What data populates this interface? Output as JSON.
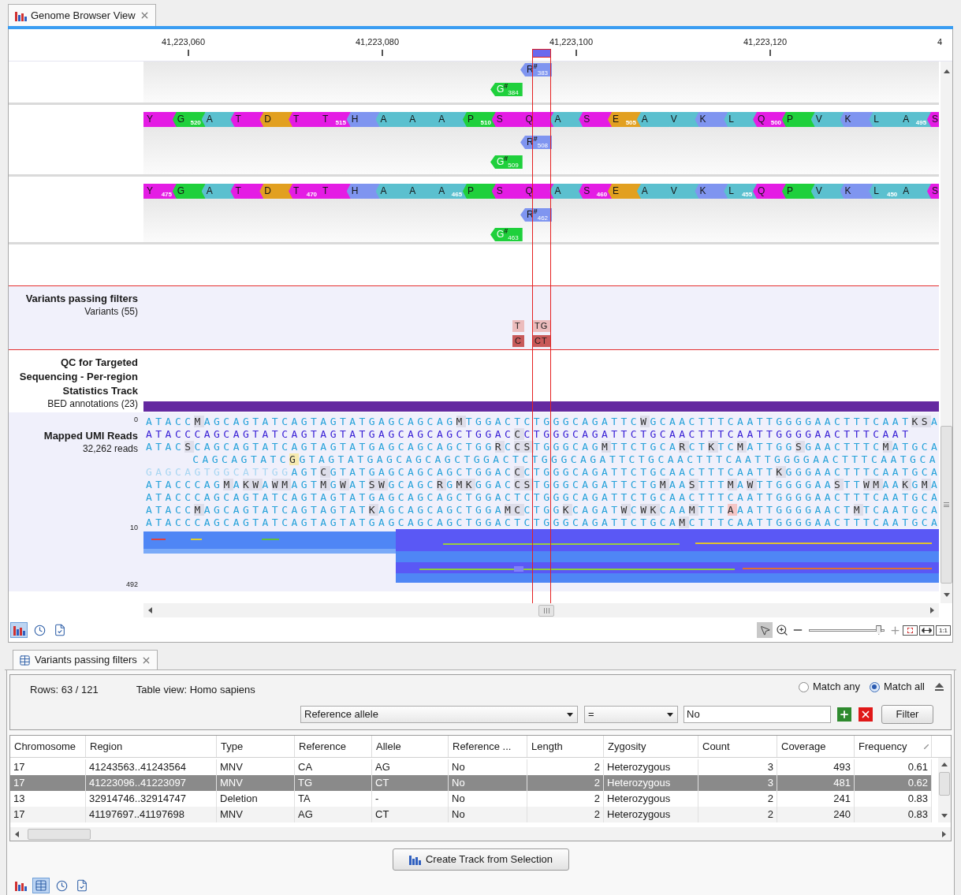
{
  "browser_tab": {
    "title": "Genome Browser View"
  },
  "ruler": {
    "ticks": [
      "41,223,060",
      "41,223,080",
      "41,223,100",
      "41,223,120",
      "4"
    ]
  },
  "translation_tracks": [
    {
      "features": [
        {
          "letter": "R",
          "mark": "#",
          "number": "383",
          "color": "#7f95f0"
        },
        {
          "letter": "G",
          "mark": "#",
          "number": "384",
          "color": "#1fd03c"
        }
      ]
    },
    {
      "amino_acids": [
        {
          "letter": "Y",
          "color": "#e41ce4"
        },
        {
          "letter": "G",
          "number": "520",
          "color": "#1fd03c"
        },
        {
          "letter": "A",
          "color": "#5bc0cf"
        },
        {
          "letter": "T",
          "color": "#e41ce4"
        },
        {
          "letter": "D",
          "color": "#e2a020"
        },
        {
          "letter": "T",
          "color": "#e41ce4"
        },
        {
          "letter": "T",
          "number": "515",
          "color": "#e41ce4"
        },
        {
          "letter": "H",
          "color": "#7f95f0"
        },
        {
          "letter": "A",
          "color": "#5bc0cf"
        },
        {
          "letter": "A",
          "color": "#5bc0cf"
        },
        {
          "letter": "A",
          "color": "#5bc0cf"
        },
        {
          "letter": "P",
          "number": "510",
          "color": "#1fd03c"
        },
        {
          "letter": "S",
          "color": "#e41ce4"
        },
        {
          "letter": "Q",
          "color": "#e41ce4"
        },
        {
          "letter": "A",
          "color": "#5bc0cf"
        },
        {
          "letter": "S",
          "color": "#e41ce4"
        },
        {
          "letter": "E",
          "number": "505",
          "color": "#e2a020"
        },
        {
          "letter": "A",
          "color": "#5bc0cf"
        },
        {
          "letter": "V",
          "color": "#5bc0cf"
        },
        {
          "letter": "K",
          "color": "#7f95f0"
        },
        {
          "letter": "L",
          "color": "#5bc0cf"
        },
        {
          "letter": "Q",
          "number": "500",
          "color": "#e41ce4"
        },
        {
          "letter": "P",
          "color": "#1fd03c"
        },
        {
          "letter": "V",
          "color": "#5bc0cf"
        },
        {
          "letter": "K",
          "color": "#7f95f0"
        },
        {
          "letter": "L",
          "color": "#5bc0cf"
        },
        {
          "letter": "A",
          "number": "495",
          "color": "#5bc0cf"
        },
        {
          "letter": "S",
          "color": "#e41ce4"
        }
      ],
      "features": [
        {
          "letter": "R",
          "mark": "#",
          "number": "508",
          "color": "#7f95f0"
        },
        {
          "letter": "G",
          "mark": "#",
          "number": "509",
          "color": "#1fd03c"
        }
      ]
    },
    {
      "amino_acids": [
        {
          "letter": "Y",
          "number": "475",
          "color": "#e41ce4"
        },
        {
          "letter": "G",
          "color": "#1fd03c"
        },
        {
          "letter": "A",
          "color": "#5bc0cf"
        },
        {
          "letter": "T",
          "color": "#e41ce4"
        },
        {
          "letter": "D",
          "color": "#e2a020"
        },
        {
          "letter": "T",
          "number": "470",
          "color": "#e41ce4"
        },
        {
          "letter": "T",
          "color": "#e41ce4"
        },
        {
          "letter": "H",
          "color": "#7f95f0"
        },
        {
          "letter": "A",
          "color": "#5bc0cf"
        },
        {
          "letter": "A",
          "color": "#5bc0cf"
        },
        {
          "letter": "A",
          "number": "465",
          "color": "#5bc0cf"
        },
        {
          "letter": "P",
          "color": "#1fd03c"
        },
        {
          "letter": "S",
          "color": "#e41ce4"
        },
        {
          "letter": "Q",
          "color": "#e41ce4"
        },
        {
          "letter": "A",
          "color": "#5bc0cf"
        },
        {
          "letter": "S",
          "number": "460",
          "color": "#e41ce4"
        },
        {
          "letter": "E",
          "color": "#e2a020"
        },
        {
          "letter": "A",
          "color": "#5bc0cf"
        },
        {
          "letter": "V",
          "color": "#5bc0cf"
        },
        {
          "letter": "K",
          "color": "#7f95f0"
        },
        {
          "letter": "L",
          "number": "455",
          "color": "#5bc0cf"
        },
        {
          "letter": "Q",
          "color": "#e41ce4"
        },
        {
          "letter": "P",
          "color": "#1fd03c"
        },
        {
          "letter": "V",
          "color": "#5bc0cf"
        },
        {
          "letter": "K",
          "color": "#7f95f0"
        },
        {
          "letter": "L",
          "number": "450",
          "color": "#5bc0cf"
        },
        {
          "letter": "A",
          "color": "#5bc0cf"
        },
        {
          "letter": "S",
          "color": "#e41ce4"
        }
      ],
      "features": [
        {
          "letter": "R",
          "mark": "#",
          "number": "462",
          "color": "#7f95f0"
        },
        {
          "letter": "G",
          "mark": "#",
          "number": "463",
          "color": "#1fd03c"
        }
      ]
    }
  ],
  "variant_track": {
    "title": "Variants passing filters",
    "subtitle": "Variants (55)",
    "variants": [
      {
        "reference": "T",
        "allele": "C"
      },
      {
        "reference": "TG",
        "allele": "CT"
      }
    ]
  },
  "qc_track": {
    "title": "QC for Targeted Sequencing - Per-region Statistics Track",
    "subtitle": "BED annotations (23)"
  },
  "reads_track": {
    "title": "Mapped UMI Reads",
    "subtitle": "32,262 reads",
    "axis": [
      "0",
      "10",
      "492"
    ],
    "reads": [
      {
        "kind": "read",
        "segments": [
          {
            "text": "ATACC",
            "kind": "match"
          },
          {
            "text": "M",
            "kind": "variant"
          },
          {
            "text": "AGCAGTATCAGTAGTATGAGCAGCAG",
            "kind": "match"
          },
          {
            "text": "M",
            "kind": "variant"
          },
          {
            "text": "TGGACTCTGGGCAGATTC",
            "kind": "match"
          },
          {
            "text": "W",
            "kind": "variant"
          },
          {
            "text": "GCAACTTTCAATTGGGGAACTTTCAAT",
            "kind": "match"
          },
          {
            "text": "KS",
            "kind": "variant"
          },
          {
            "text": "A",
            "kind": "match"
          }
        ]
      },
      {
        "kind": "consensus",
        "segments": [
          {
            "text": "ATACCCAGCAGTATCAGTAGTATGAGCAGCAGCTGGAC",
            "kind": "match"
          },
          {
            "text": "C",
            "kind": "variant"
          },
          {
            "text": "CTGGGCAGATTCTGCAACTTTCAATTGGGGAACTTTCAAT",
            "kind": "match"
          }
        ]
      },
      {
        "kind": "read",
        "segments": [
          {
            "text": "ATAC",
            "kind": "match"
          },
          {
            "text": "S",
            "kind": "variant"
          },
          {
            "text": "CAGCAGTATCAGTAGTATGAGCAGCAGCTGG",
            "kind": "match"
          },
          {
            "text": "R",
            "kind": "variant"
          },
          {
            "text": "C",
            "kind": "match"
          },
          {
            "text": "CS",
            "kind": "variant"
          },
          {
            "text": "TGGGCAG",
            "kind": "match"
          },
          {
            "text": "M",
            "kind": "variant"
          },
          {
            "text": "TTCTGCA",
            "kind": "match"
          },
          {
            "text": "R",
            "kind": "variant"
          },
          {
            "text": "CT",
            "kind": "match"
          },
          {
            "text": "K",
            "kind": "variant"
          },
          {
            "text": "TC",
            "kind": "match"
          },
          {
            "text": "M",
            "kind": "variant"
          },
          {
            "text": "ATTGG",
            "kind": "match"
          },
          {
            "text": "S",
            "kind": "variant"
          },
          {
            "text": "GAACTTTC",
            "kind": "match"
          },
          {
            "text": "M",
            "kind": "variant"
          },
          {
            "text": "ATGCA",
            "kind": "match"
          }
        ]
      },
      {
        "kind": "partial",
        "segments": [
          {
            "text": "CAGCAGTATC",
            "kind": "match"
          },
          {
            "text": "G",
            "kind": "highlight",
            "color": "#f6eab0"
          },
          {
            "text": "GTAGTATGAGCAGCAGCTGGACTCTGGGCAGATTCTGCAACTTTCAATTGGGGAACTTTCAATGCA",
            "kind": "match"
          }
        ]
      },
      {
        "kind": "read",
        "segments": [
          {
            "text": "GAGCAGTGGCATTGG",
            "kind": "soft"
          },
          {
            "text": "AGT",
            "kind": "match"
          },
          {
            "text": "C",
            "kind": "variant"
          },
          {
            "text": "GTATGAGCAGCAGCTGGAC",
            "kind": "match"
          },
          {
            "text": "C",
            "kind": "variant"
          },
          {
            "text": "CTGGGCAGATTCTGCAACTTTCAATT",
            "kind": "match"
          },
          {
            "text": "K",
            "kind": "variant"
          },
          {
            "text": "GGGAACTTTCAATGCA",
            "kind": "match"
          }
        ]
      },
      {
        "kind": "read",
        "segments": [
          {
            "text": "ATACCCAG",
            "kind": "match"
          },
          {
            "text": "M",
            "kind": "variant"
          },
          {
            "text": "A",
            "kind": "match"
          },
          {
            "text": "KW",
            "kind": "variant"
          },
          {
            "text": "A",
            "kind": "match"
          },
          {
            "text": "WM",
            "kind": "variant"
          },
          {
            "text": "AGT",
            "kind": "match"
          },
          {
            "text": "M",
            "kind": "variant"
          },
          {
            "text": "G",
            "kind": "match"
          },
          {
            "text": "W",
            "kind": "variant"
          },
          {
            "text": "AT",
            "kind": "match"
          },
          {
            "text": "SW",
            "kind": "variant"
          },
          {
            "text": "GCAGC",
            "kind": "match"
          },
          {
            "text": "R",
            "kind": "variant"
          },
          {
            "text": "G",
            "kind": "match"
          },
          {
            "text": "MK",
            "kind": "variant"
          },
          {
            "text": "GGAC",
            "kind": "match"
          },
          {
            "text": "CS",
            "kind": "variant"
          },
          {
            "text": "TGGGCAGATTCTG",
            "kind": "match"
          },
          {
            "text": "M",
            "kind": "variant"
          },
          {
            "text": "AA",
            "kind": "match"
          },
          {
            "text": "S",
            "kind": "variant"
          },
          {
            "text": "TTT",
            "kind": "match"
          },
          {
            "text": "M",
            "kind": "variant"
          },
          {
            "text": "A",
            "kind": "match"
          },
          {
            "text": "W",
            "kind": "variant"
          },
          {
            "text": "TTGGGGAA",
            "kind": "match"
          },
          {
            "text": "S",
            "kind": "variant"
          },
          {
            "text": "TT",
            "kind": "match"
          },
          {
            "text": "WM",
            "kind": "variant"
          },
          {
            "text": "AA",
            "kind": "match"
          },
          {
            "text": "K",
            "kind": "variant"
          },
          {
            "text": "G",
            "kind": "match"
          },
          {
            "text": "M",
            "kind": "variant"
          },
          {
            "text": "A",
            "kind": "match"
          }
        ]
      },
      {
        "kind": "read",
        "segments": [
          {
            "text": "ATACCCAGCAGTATCAGTAGTATGAGCAGCAGCTGGACTCTGGGCAGATTCTGCAACTTTCAATTGGGGAACTTTCAATGCA",
            "kind": "match"
          }
        ]
      },
      {
        "kind": "read",
        "segments": [
          {
            "text": "ATACC",
            "kind": "match"
          },
          {
            "text": "M",
            "kind": "variant"
          },
          {
            "text": "AGCAGTATCAGTAGTAT",
            "kind": "match"
          },
          {
            "text": "K",
            "kind": "variant"
          },
          {
            "text": "AGCAGCAGCTGGA",
            "kind": "match"
          },
          {
            "text": "MC",
            "kind": "variant"
          },
          {
            "text": "CTGG",
            "kind": "match"
          },
          {
            "text": "K",
            "kind": "variant"
          },
          {
            "text": "CAGAT",
            "kind": "match"
          },
          {
            "text": "W",
            "kind": "variant"
          },
          {
            "text": "C",
            "kind": "match"
          },
          {
            "text": "WK",
            "kind": "variant"
          },
          {
            "text": "CAA",
            "kind": "match"
          },
          {
            "text": "M",
            "kind": "variant"
          },
          {
            "text": "TTT",
            "kind": "match"
          },
          {
            "text": "A",
            "kind": "highlight",
            "color": "#f5c6c6"
          },
          {
            "text": "AATTGGGGAACT",
            "kind": "match"
          },
          {
            "text": "M",
            "kind": "variant"
          },
          {
            "text": "TCAATGCA",
            "kind": "match"
          }
        ]
      },
      {
        "kind": "read",
        "segments": [
          {
            "text": "ATACCCAGCAGTATCAGTAGTATGAGCAGCAGCTGGACTCTGGGCAGATTCTGCA",
            "kind": "match"
          },
          {
            "text": "M",
            "kind": "variant"
          },
          {
            "text": "CTTTCAATTGGGGAACTTTCAATGCA",
            "kind": "match"
          }
        ]
      }
    ]
  },
  "browser_toolbar": {
    "views": [
      {
        "kind": "chart",
        "selected": true
      },
      {
        "kind": "history",
        "selected": false
      },
      {
        "kind": "check",
        "selected": false
      }
    ],
    "modes": [
      {
        "kind": "select",
        "selected": true
      },
      {
        "kind": "zoom",
        "selected": false
      }
    ],
    "zoom_slider": {
      "level": 0.93
    },
    "fit_buttons": [
      {
        "kind": "fit-selection"
      },
      {
        "kind": "fit-width"
      },
      {
        "kind": "actual-size",
        "label": "1:1"
      }
    ]
  },
  "table_panel": {
    "tab": {
      "title": "Variants passing filters"
    },
    "rows_info": "Rows: 63 / 121",
    "table_view": "Table view: Homo sapiens",
    "match_options": [
      {
        "label": "Match any",
        "selected": false
      },
      {
        "label": "Match all",
        "selected": true
      }
    ],
    "filter": {
      "column": "Reference allele",
      "operator": "=",
      "value": "No",
      "button": "Filter"
    },
    "columns": [
      {
        "label": "Chromosome",
        "kind": "text",
        "sorted": false
      },
      {
        "label": "Region",
        "kind": "text",
        "sorted": false
      },
      {
        "label": "Type",
        "kind": "text",
        "sorted": false
      },
      {
        "label": "Reference",
        "kind": "text",
        "sorted": false
      },
      {
        "label": "Allele",
        "kind": "text",
        "sorted": false
      },
      {
        "label": "Reference ...",
        "kind": "text",
        "sorted": false
      },
      {
        "label": "Length",
        "kind": "number",
        "sorted": false
      },
      {
        "label": "Zygosity",
        "kind": "text",
        "sorted": false
      },
      {
        "label": "Count",
        "kind": "number",
        "sorted": false
      },
      {
        "label": "Coverage",
        "kind": "number",
        "sorted": false
      },
      {
        "label": "Frequency",
        "kind": "number",
        "sorted": true
      }
    ],
    "rows": [
      {
        "selected": false,
        "cells": [
          "17",
          "41243563..41243564",
          "MNV",
          "CA",
          "AG",
          "No",
          "2",
          "Heterozygous",
          "3",
          "493",
          "0.61"
        ]
      },
      {
        "selected": true,
        "cells": [
          "17",
          "41223096..41223097",
          "MNV",
          "TG",
          "CT",
          "No",
          "2",
          "Heterozygous",
          "3",
          "481",
          "0.62"
        ]
      },
      {
        "selected": false,
        "cells": [
          "13",
          "32914746..32914747",
          "Deletion",
          "TA",
          "-",
          "No",
          "2",
          "Heterozygous",
          "2",
          "241",
          "0.83"
        ]
      },
      {
        "selected": false,
        "cells": [
          "17",
          "41197697..41197698",
          "MNV",
          "AG",
          "CT",
          "No",
          "2",
          "Heterozygous",
          "2",
          "240",
          "0.83"
        ]
      }
    ],
    "action_button": "Create Track from Selection",
    "views": [
      {
        "kind": "chart",
        "selected": false
      },
      {
        "kind": "table",
        "selected": true
      },
      {
        "kind": "history",
        "selected": false
      },
      {
        "kind": "check",
        "selected": false
      }
    ]
  }
}
